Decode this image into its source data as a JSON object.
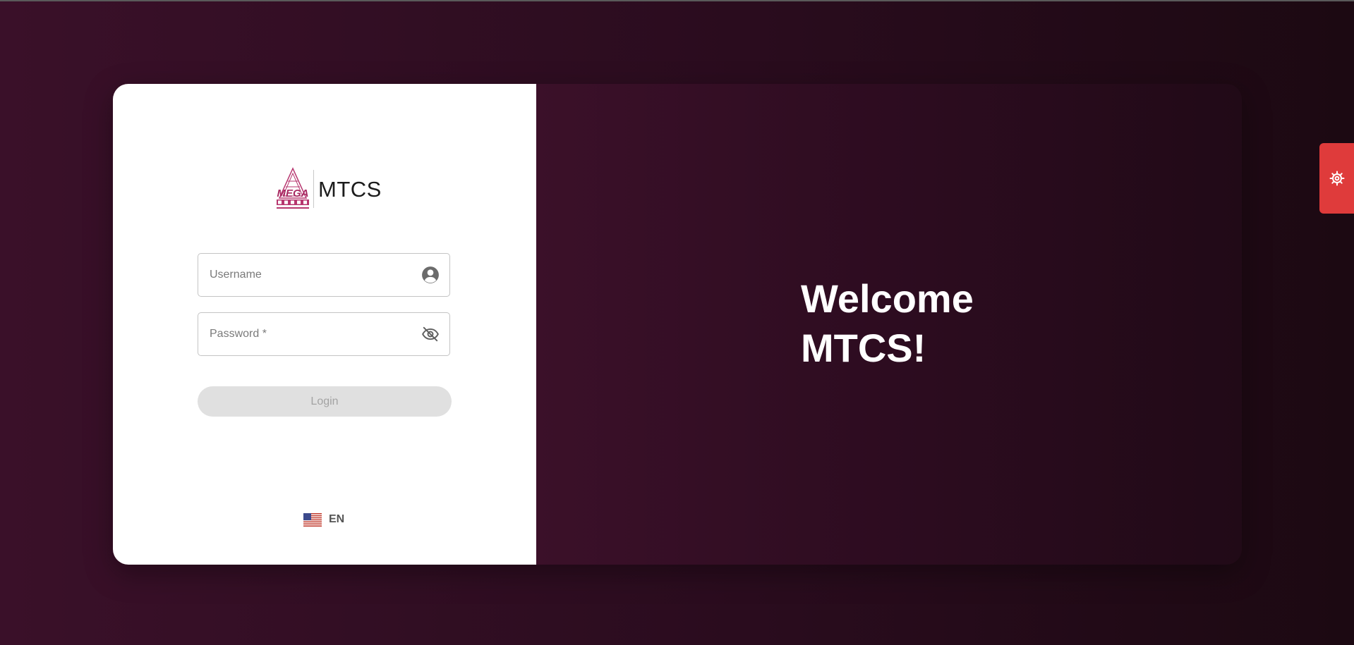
{
  "app": {
    "logo_alt": "MEGA GROUP",
    "logo_text": "MTCS",
    "logo_icon": "mega-group-logo-icon"
  },
  "form": {
    "username": {
      "placeholder": "Username",
      "value": "",
      "icon": "user-circle-icon"
    },
    "password": {
      "placeholder": "Password *",
      "value": "",
      "icon": "eye-off-icon"
    },
    "login_label": "Login"
  },
  "language": {
    "code": "EN",
    "flag_icon": "us-flag-icon"
  },
  "hero": {
    "line1": "Welcome",
    "line2": "MTCS!"
  },
  "settings": {
    "icon": "gear-icon"
  },
  "colors": {
    "brand_dark": "#3a1029",
    "settings_tab": "#df3b3b",
    "button_disabled": "#e0e0e0"
  }
}
